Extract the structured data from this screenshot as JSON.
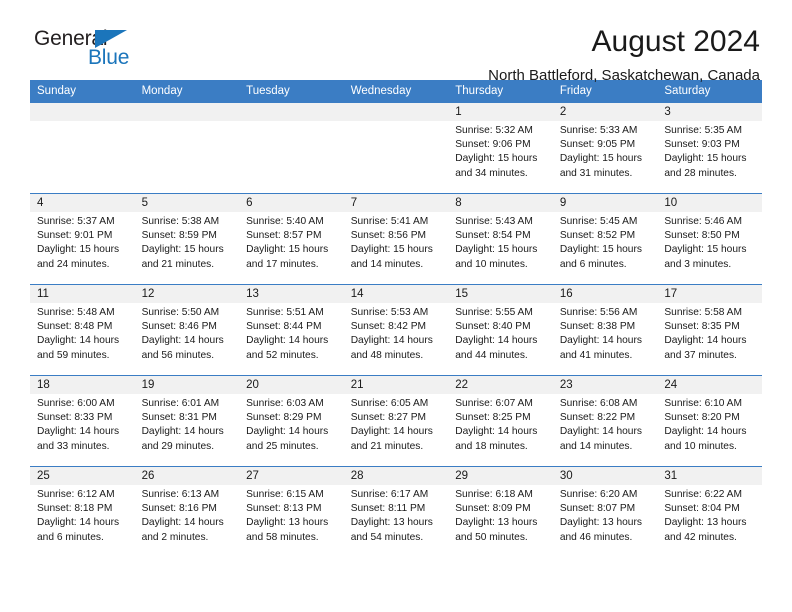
{
  "brand": {
    "name_part1": "General",
    "name_part2": "Blue",
    "triangle_color": "#1b75bb",
    "text_color": "#231f20"
  },
  "header": {
    "title": "August 2024",
    "subtitle": "North Battleford, Saskatchewan, Canada"
  },
  "theme": {
    "header_bg": "#3b7dc4",
    "header_text": "#ffffff",
    "daynum_band_bg": "#f1f1f1",
    "cell_bg": "#ffffff",
    "grid_line": "#3b7dc4"
  },
  "weekday_headers": [
    "Sunday",
    "Monday",
    "Tuesday",
    "Wednesday",
    "Thursday",
    "Friday",
    "Saturday"
  ],
  "labels": {
    "sunrise_prefix": "Sunrise: ",
    "sunset_prefix": "Sunset: ",
    "daylight_prefix": "Daylight: "
  },
  "weeks": [
    [
      {
        "day": "",
        "sunrise": "",
        "sunset": "",
        "daylight_line1": "",
        "daylight_line2": "",
        "empty": true
      },
      {
        "day": "",
        "sunrise": "",
        "sunset": "",
        "daylight_line1": "",
        "daylight_line2": "",
        "empty": true
      },
      {
        "day": "",
        "sunrise": "",
        "sunset": "",
        "daylight_line1": "",
        "daylight_line2": "",
        "empty": true
      },
      {
        "day": "",
        "sunrise": "",
        "sunset": "",
        "daylight_line1": "",
        "daylight_line2": "",
        "empty": true
      },
      {
        "day": "1",
        "sunrise": "Sunrise: 5:32 AM",
        "sunset": "Sunset: 9:06 PM",
        "daylight_line1": "Daylight: 15 hours",
        "daylight_line2": "and 34 minutes.",
        "empty": false
      },
      {
        "day": "2",
        "sunrise": "Sunrise: 5:33 AM",
        "sunset": "Sunset: 9:05 PM",
        "daylight_line1": "Daylight: 15 hours",
        "daylight_line2": "and 31 minutes.",
        "empty": false
      },
      {
        "day": "3",
        "sunrise": "Sunrise: 5:35 AM",
        "sunset": "Sunset: 9:03 PM",
        "daylight_line1": "Daylight: 15 hours",
        "daylight_line2": "and 28 minutes.",
        "empty": false
      }
    ],
    [
      {
        "day": "4",
        "sunrise": "Sunrise: 5:37 AM",
        "sunset": "Sunset: 9:01 PM",
        "daylight_line1": "Daylight: 15 hours",
        "daylight_line2": "and 24 minutes.",
        "empty": false
      },
      {
        "day": "5",
        "sunrise": "Sunrise: 5:38 AM",
        "sunset": "Sunset: 8:59 PM",
        "daylight_line1": "Daylight: 15 hours",
        "daylight_line2": "and 21 minutes.",
        "empty": false
      },
      {
        "day": "6",
        "sunrise": "Sunrise: 5:40 AM",
        "sunset": "Sunset: 8:57 PM",
        "daylight_line1": "Daylight: 15 hours",
        "daylight_line2": "and 17 minutes.",
        "empty": false
      },
      {
        "day": "7",
        "sunrise": "Sunrise: 5:41 AM",
        "sunset": "Sunset: 8:56 PM",
        "daylight_line1": "Daylight: 15 hours",
        "daylight_line2": "and 14 minutes.",
        "empty": false
      },
      {
        "day": "8",
        "sunrise": "Sunrise: 5:43 AM",
        "sunset": "Sunset: 8:54 PM",
        "daylight_line1": "Daylight: 15 hours",
        "daylight_line2": "and 10 minutes.",
        "empty": false
      },
      {
        "day": "9",
        "sunrise": "Sunrise: 5:45 AM",
        "sunset": "Sunset: 8:52 PM",
        "daylight_line1": "Daylight: 15 hours",
        "daylight_line2": "and 6 minutes.",
        "empty": false
      },
      {
        "day": "10",
        "sunrise": "Sunrise: 5:46 AM",
        "sunset": "Sunset: 8:50 PM",
        "daylight_line1": "Daylight: 15 hours",
        "daylight_line2": "and 3 minutes.",
        "empty": false
      }
    ],
    [
      {
        "day": "11",
        "sunrise": "Sunrise: 5:48 AM",
        "sunset": "Sunset: 8:48 PM",
        "daylight_line1": "Daylight: 14 hours",
        "daylight_line2": "and 59 minutes.",
        "empty": false
      },
      {
        "day": "12",
        "sunrise": "Sunrise: 5:50 AM",
        "sunset": "Sunset: 8:46 PM",
        "daylight_line1": "Daylight: 14 hours",
        "daylight_line2": "and 56 minutes.",
        "empty": false
      },
      {
        "day": "13",
        "sunrise": "Sunrise: 5:51 AM",
        "sunset": "Sunset: 8:44 PM",
        "daylight_line1": "Daylight: 14 hours",
        "daylight_line2": "and 52 minutes.",
        "empty": false
      },
      {
        "day": "14",
        "sunrise": "Sunrise: 5:53 AM",
        "sunset": "Sunset: 8:42 PM",
        "daylight_line1": "Daylight: 14 hours",
        "daylight_line2": "and 48 minutes.",
        "empty": false
      },
      {
        "day": "15",
        "sunrise": "Sunrise: 5:55 AM",
        "sunset": "Sunset: 8:40 PM",
        "daylight_line1": "Daylight: 14 hours",
        "daylight_line2": "and 44 minutes.",
        "empty": false
      },
      {
        "day": "16",
        "sunrise": "Sunrise: 5:56 AM",
        "sunset": "Sunset: 8:38 PM",
        "daylight_line1": "Daylight: 14 hours",
        "daylight_line2": "and 41 minutes.",
        "empty": false
      },
      {
        "day": "17",
        "sunrise": "Sunrise: 5:58 AM",
        "sunset": "Sunset: 8:35 PM",
        "daylight_line1": "Daylight: 14 hours",
        "daylight_line2": "and 37 minutes.",
        "empty": false
      }
    ],
    [
      {
        "day": "18",
        "sunrise": "Sunrise: 6:00 AM",
        "sunset": "Sunset: 8:33 PM",
        "daylight_line1": "Daylight: 14 hours",
        "daylight_line2": "and 33 minutes.",
        "empty": false
      },
      {
        "day": "19",
        "sunrise": "Sunrise: 6:01 AM",
        "sunset": "Sunset: 8:31 PM",
        "daylight_line1": "Daylight: 14 hours",
        "daylight_line2": "and 29 minutes.",
        "empty": false
      },
      {
        "day": "20",
        "sunrise": "Sunrise: 6:03 AM",
        "sunset": "Sunset: 8:29 PM",
        "daylight_line1": "Daylight: 14 hours",
        "daylight_line2": "and 25 minutes.",
        "empty": false
      },
      {
        "day": "21",
        "sunrise": "Sunrise: 6:05 AM",
        "sunset": "Sunset: 8:27 PM",
        "daylight_line1": "Daylight: 14 hours",
        "daylight_line2": "and 21 minutes.",
        "empty": false
      },
      {
        "day": "22",
        "sunrise": "Sunrise: 6:07 AM",
        "sunset": "Sunset: 8:25 PM",
        "daylight_line1": "Daylight: 14 hours",
        "daylight_line2": "and 18 minutes.",
        "empty": false
      },
      {
        "day": "23",
        "sunrise": "Sunrise: 6:08 AM",
        "sunset": "Sunset: 8:22 PM",
        "daylight_line1": "Daylight: 14 hours",
        "daylight_line2": "and 14 minutes.",
        "empty": false
      },
      {
        "day": "24",
        "sunrise": "Sunrise: 6:10 AM",
        "sunset": "Sunset: 8:20 PM",
        "daylight_line1": "Daylight: 14 hours",
        "daylight_line2": "and 10 minutes.",
        "empty": false
      }
    ],
    [
      {
        "day": "25",
        "sunrise": "Sunrise: 6:12 AM",
        "sunset": "Sunset: 8:18 PM",
        "daylight_line1": "Daylight: 14 hours",
        "daylight_line2": "and 6 minutes.",
        "empty": false
      },
      {
        "day": "26",
        "sunrise": "Sunrise: 6:13 AM",
        "sunset": "Sunset: 8:16 PM",
        "daylight_line1": "Daylight: 14 hours",
        "daylight_line2": "and 2 minutes.",
        "empty": false
      },
      {
        "day": "27",
        "sunrise": "Sunrise: 6:15 AM",
        "sunset": "Sunset: 8:13 PM",
        "daylight_line1": "Daylight: 13 hours",
        "daylight_line2": "and 58 minutes.",
        "empty": false
      },
      {
        "day": "28",
        "sunrise": "Sunrise: 6:17 AM",
        "sunset": "Sunset: 8:11 PM",
        "daylight_line1": "Daylight: 13 hours",
        "daylight_line2": "and 54 minutes.",
        "empty": false
      },
      {
        "day": "29",
        "sunrise": "Sunrise: 6:18 AM",
        "sunset": "Sunset: 8:09 PM",
        "daylight_line1": "Daylight: 13 hours",
        "daylight_line2": "and 50 minutes.",
        "empty": false
      },
      {
        "day": "30",
        "sunrise": "Sunrise: 6:20 AM",
        "sunset": "Sunset: 8:07 PM",
        "daylight_line1": "Daylight: 13 hours",
        "daylight_line2": "and 46 minutes.",
        "empty": false
      },
      {
        "day": "31",
        "sunrise": "Sunrise: 6:22 AM",
        "sunset": "Sunset: 8:04 PM",
        "daylight_line1": "Daylight: 13 hours",
        "daylight_line2": "and 42 minutes.",
        "empty": false
      }
    ]
  ]
}
